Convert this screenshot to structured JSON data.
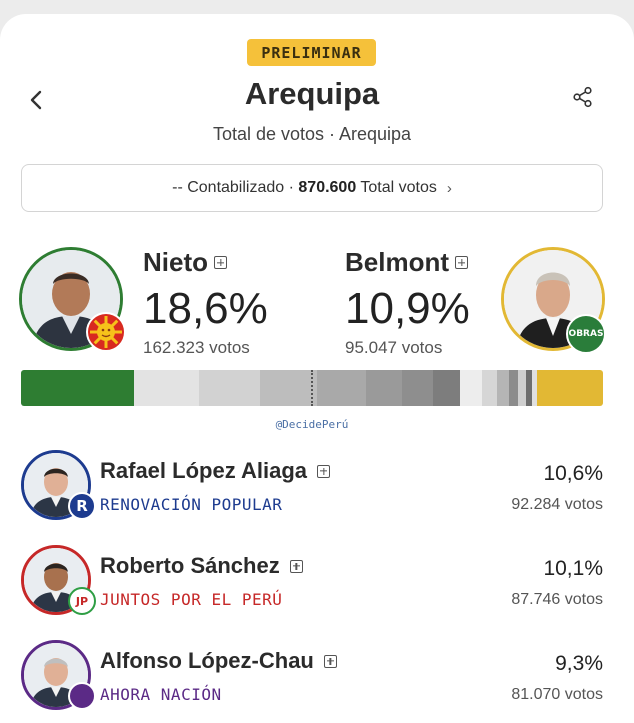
{
  "badge": "PRELIMINAR",
  "header": {
    "title": "Arequipa",
    "subtitle": "Total de votos · Arequipa"
  },
  "count": {
    "prefix": "-- Contabilizado · ",
    "total": "870.600",
    "suffix": " Total votos",
    "chevron": "›"
  },
  "leaders": [
    {
      "name": "Nieto",
      "pct": "18,6%",
      "votes": "162.323 votos",
      "color": "#2e7d32",
      "party_icon": "sun-logo-icon"
    },
    {
      "name": "Belmont",
      "pct": "10,9%",
      "votes": "95.047 votos",
      "color": "#e2b834",
      "party_logo_text": "OBRAS"
    }
  ],
  "vote_bar": {
    "segments": [
      {
        "share": 0.186,
        "color": "#2e7d32"
      },
      {
        "share": 0.106,
        "color": "#e3e3e3"
      },
      {
        "share": 0.101,
        "color": "#d2d2d2"
      },
      {
        "share": 0.093,
        "color": "#bdbdbd"
      },
      {
        "share": 0.08,
        "color": "#a9a9a9"
      },
      {
        "share": 0.06,
        "color": "#9a9a9a"
      },
      {
        "share": 0.05,
        "color": "#8e8e8e"
      },
      {
        "share": 0.045,
        "color": "#7d7d7d"
      },
      {
        "share": 0.035,
        "color": "#ededed"
      },
      {
        "share": 0.025,
        "color": "#d6d6d6"
      },
      {
        "share": 0.02,
        "color": "#b5b5b5"
      },
      {
        "share": 0.015,
        "color": "#8c8c8c"
      },
      {
        "share": 0.012,
        "color": "#cfcfcf"
      },
      {
        "share": 0.01,
        "color": "#6e6e6e"
      },
      {
        "share": 0.008,
        "color": "#e0e0e0"
      },
      {
        "share": 0.109,
        "color": "#e2b834"
      }
    ]
  },
  "watermark": "@DecidePerú",
  "candidates": [
    {
      "name": "Rafael López Aliaga",
      "party": "RENOVACIÓN POPULAR",
      "party_color": "#1d3b8f",
      "ring": "#1d3b8f",
      "pct": "10,6%",
      "votes": "92.284 votos",
      "logo_text": "R"
    },
    {
      "name": "Roberto Sánchez",
      "party": "JUNTOS POR EL PERÚ",
      "party_color": "#c62828",
      "ring": "#c62828",
      "pct": "10,1%",
      "votes": "87.746 votos",
      "logo_text": "JP"
    },
    {
      "name": "Alfonso López-Chau",
      "party": "AHORA NACIÓN",
      "party_color": "#5b2a86",
      "ring": "#5b2a86",
      "pct": "9,3%",
      "votes": "81.070 votos",
      "logo_text": ""
    }
  ]
}
